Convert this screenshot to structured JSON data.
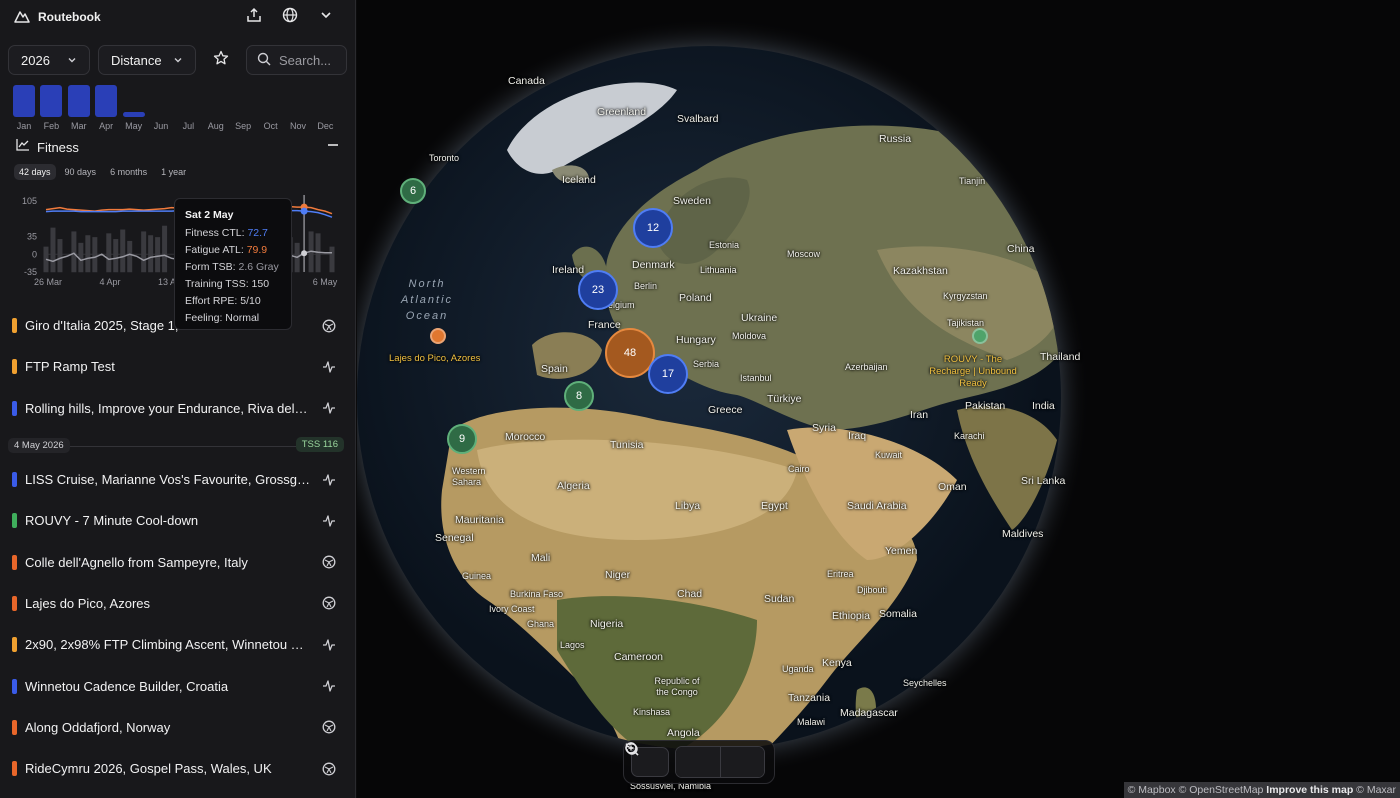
{
  "app": {
    "name": "Routebook"
  },
  "header_icons": [
    "upload-icon",
    "globe-icon",
    "chevron-down-icon"
  ],
  "filters": {
    "year": "2026",
    "metric": "Distance",
    "search_placeholder": "Search..."
  },
  "months": {
    "labels": [
      "Jan",
      "Feb",
      "Mar",
      "Apr",
      "May",
      "Jun",
      "Jul",
      "Aug",
      "Sep",
      "Oct",
      "Nov",
      "Dec"
    ],
    "level": [
      1,
      1,
      1,
      1,
      0.15,
      0,
      0,
      0,
      0,
      0,
      0,
      0
    ],
    "bar_color": "#2a3fb7"
  },
  "fitness": {
    "title": "Fitness",
    "ranges": [
      "42 days",
      "90 days",
      "6 months",
      "1 year"
    ],
    "active_range": "42 days"
  },
  "chart_data": {
    "type": "line",
    "y_ticks": [
      "105",
      "35",
      "0",
      "-35"
    ],
    "x_ticks": [
      "26 Mar",
      "4 Apr",
      "13 Apr",
      "6 May"
    ],
    "ylim": [
      -35,
      105
    ],
    "series": [
      {
        "values": [
          88,
          90,
          92,
          89,
          88,
          87,
          86,
          85,
          87,
          88,
          88,
          88,
          89,
          88,
          87,
          88,
          89,
          90,
          92,
          91,
          90,
          89,
          88,
          89,
          90,
          91,
          92,
          93,
          92,
          93,
          94,
          95,
          96,
          95,
          94,
          94,
          93,
          93,
          92,
          88,
          85,
          80
        ],
        "color": "#f07a3c"
      },
      {
        "values": [
          84,
          85,
          85,
          85,
          85,
          84,
          84,
          84,
          84,
          84,
          84,
          85,
          85,
          85,
          85,
          85,
          85,
          85,
          85,
          86,
          86,
          86,
          86,
          86,
          86,
          86,
          86,
          86,
          87,
          87,
          87,
          87,
          87,
          87,
          86,
          86,
          86,
          85,
          84,
          82,
          78,
          73
        ],
        "color": "#4f7df5"
      },
      {
        "values": [
          -10,
          -14,
          -8,
          -4,
          2,
          -12,
          -8,
          -6,
          0,
          -10,
          -8,
          -5,
          0,
          -4,
          -12,
          -6,
          -4,
          -2,
          -8,
          -10,
          -6,
          -4,
          -2,
          0,
          -4,
          -6,
          -2,
          -4,
          -5,
          -6,
          -2,
          -4,
          -6,
          -8,
          -4,
          -2,
          -6,
          2,
          6,
          4,
          3,
          3
        ],
        "color": "#9a9aa2"
      }
    ],
    "bars": [
      20,
      70,
      40,
      0,
      60,
      30,
      50,
      45,
      0,
      55,
      40,
      65,
      35,
      0,
      60,
      50,
      45,
      75,
      0,
      55,
      60,
      50,
      0,
      40,
      55,
      65,
      45,
      50,
      0,
      60,
      70,
      55,
      40,
      0,
      50,
      45,
      30,
      0,
      60,
      55,
      0,
      20
    ],
    "marker_index": 37
  },
  "tooltip": {
    "date": "Sat 2 May",
    "ctl_label": "Fitness CTL:",
    "ctl_value": "72.7",
    "atl_label": "Fatigue ATL:",
    "atl_value": "79.9",
    "tsb_label": "Form TSB:",
    "tsb_value": "2.6 Gray",
    "tss_label": "Training TSS:",
    "tss_value": "150",
    "rpe_label": "Effort RPE:",
    "rpe_value": "5/10",
    "feel_label": "Feeling:",
    "feel_value": "Normal"
  },
  "activities_before": [
    {
      "name": "Giro d'Italia 2025, Stage 1, Albania",
      "color": "#f0a030",
      "icon": "route-icon"
    },
    {
      "name": "FTP Ramp Test",
      "color": "#f0a030",
      "icon": "activity-icon"
    },
    {
      "name": "Rolling hills, Improve your Endurance, Riva del Garda",
      "color": "#3a5be8",
      "icon": "activity-icon"
    }
  ],
  "divider": {
    "date": "4 May 2026",
    "tss": "TSS 116"
  },
  "activities_after": [
    {
      "name": "LISS Cruise, Marianne Vos's Favourite, Grossglockner",
      "color": "#3a5be8",
      "icon": "activity-icon"
    },
    {
      "name": "ROUVY - 7 Minute Cool-down",
      "color": "#3fae5c",
      "icon": "activity-icon"
    },
    {
      "name": "Colle dell'Agnello from Sampeyre, Italy",
      "color": "#e8662a",
      "icon": "route-icon"
    },
    {
      "name": "Lajes do Pico, Azores",
      "color": "#e8662a",
      "icon": "route-icon"
    },
    {
      "name": "2x90, 2x98% FTP Climbing Ascent, Winnetou Climb",
      "color": "#f0a030",
      "icon": "activity-icon"
    },
    {
      "name": "Winnetou Cadence Builder, Croatia",
      "color": "#3a5be8",
      "icon": "activity-icon"
    },
    {
      "name": "Along Oddafjord, Norway",
      "color": "#e8662a",
      "icon": "route-icon"
    },
    {
      "name": "RideCymru 2026, Gospel Pass, Wales, UK",
      "color": "#e8662a",
      "icon": "route-icon"
    }
  ],
  "map": {
    "places": [
      "Canada",
      "Greenland",
      "Svalbard",
      "Russia",
      "Toronto",
      "Iceland",
      "Sweden",
      "Tianjin",
      "Estonia",
      "China",
      "Moscow",
      "Ireland",
      "Denmark",
      "Lithuania",
      "Kazakhstan",
      "Berlin",
      "Poland",
      "Kyrgyzstan",
      "Belgium",
      "Ukraine",
      "Tajikistan",
      "France",
      "Moldova",
      "Hungary",
      "Serbia",
      "Spain",
      "Istanbul",
      "Azerbaijan",
      "Thailand",
      "Türkiye",
      "Greece",
      "Iran",
      "Pakistan",
      "India",
      "Morocco",
      "Tunisia",
      "Syria",
      "Iraq",
      "Karachi",
      "Kuwait",
      "Sri Lanka",
      "Western Sahara",
      "Cairo",
      "Oman",
      "Algeria",
      "Libya",
      "Egypt",
      "Saudi Arabia",
      "Maldives",
      "Mauritania",
      "Senegal",
      "Yemen",
      "Mali",
      "Eritrea",
      "Niger",
      "Guinea",
      "Burkina Faso",
      "Chad",
      "Djibouti",
      "Sudan",
      "Ethiopia",
      "Somalia",
      "Ivory Coast",
      "Ghana",
      "Nigeria",
      "Lagos",
      "Cameroon",
      "Kenya",
      "Uganda",
      "Republic of the Congo",
      "Kinshasa",
      "Tanzania",
      "Seychelles",
      "Malawi",
      "Angola",
      "Madagascar",
      "Sossusvlei, Namibia"
    ],
    "ocean": "North Atlantic Ocean",
    "poi_azores": "Lajes do Pico, Azores",
    "poi_rouvy": "ROUVY - The Recharge | Unbound Ready",
    "clusters": [
      "6",
      "12",
      "23",
      "48",
      "17",
      "8",
      "9"
    ],
    "attribution": {
      "mapbox": "© Mapbox",
      "osm": "© OpenStreetMap",
      "improve": "Improve this map",
      "maxar": "© Maxar"
    }
  }
}
